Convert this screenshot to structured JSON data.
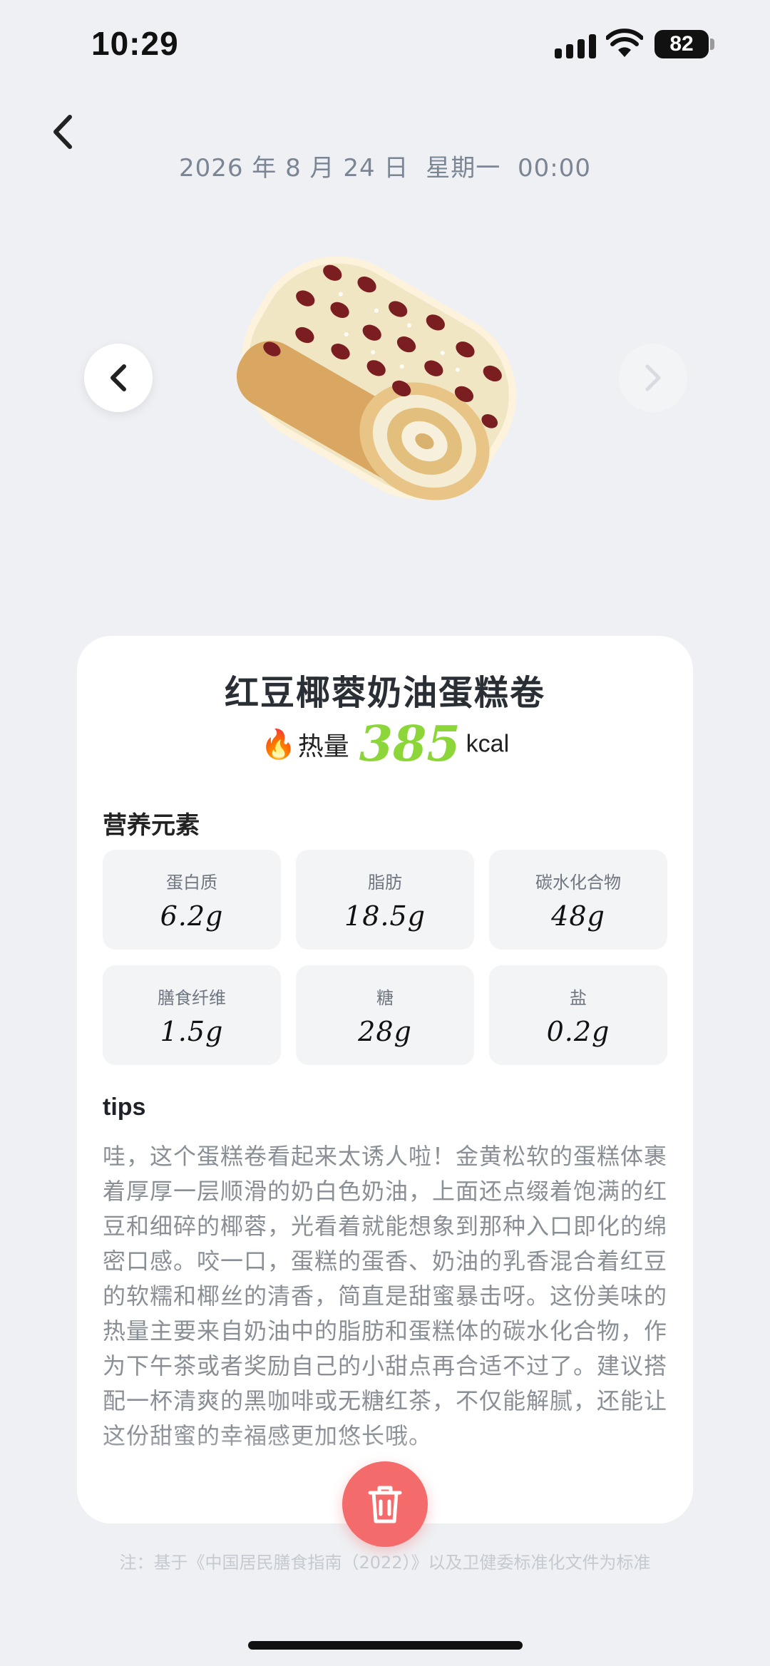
{
  "status_bar": {
    "time": "10:29",
    "battery": "82"
  },
  "header": {
    "date": "2026 年 8 月 24 日",
    "weekday": "星期一",
    "time": "00:00"
  },
  "food": {
    "title": "红豆椰蓉奶油蛋糕卷",
    "calorie_label": "热量",
    "calorie_value": "385",
    "calorie_unit": "kcal"
  },
  "nutrition": {
    "section_label": "营养元素",
    "items": [
      {
        "name": "蛋白质",
        "value": "6.2g"
      },
      {
        "name": "脂肪",
        "value": "18.5g"
      },
      {
        "name": "碳水化合物",
        "value": "48g"
      },
      {
        "name": "膳食纤维",
        "value": "1.5g"
      },
      {
        "name": "糖",
        "value": "28g"
      },
      {
        "name": "盐",
        "value": "0.2g"
      }
    ]
  },
  "tips": {
    "label": "tips",
    "text": "哇，这个蛋糕卷看起来太诱人啦！金黄松软的蛋糕体裹着厚厚一层顺滑的奶白色奶油，上面还点缀着饱满的红豆和细碎的椰蓉，光看着就能想象到那种入口即化的绵密口感。咬一口，蛋糕的蛋香、奶油的乳香混合着红豆的软糯和椰丝的清香，简直是甜蜜暴击呀。这份美味的热量主要来自奶油中的脂肪和蛋糕体的碳水化合物，作为下午茶或者奖励自己的小甜点再合适不过了。建议搭配一杯清爽的黑咖啡或无糖红茶，不仅能解腻，还能让这份甜蜜的幸福感更加悠长哦。"
  },
  "footnote": "注：基于《中国居民膳食指南（2022）》以及卫健委标准化文件为标准",
  "icons": {
    "back": "chevron-left-icon",
    "prev": "chevron-left-icon",
    "next": "chevron-right-icon",
    "delete": "trash-icon",
    "calorie": "fire-icon"
  },
  "colors": {
    "accent_green": "#8cd63a",
    "delete_red": "#f46b6b",
    "background": "#eef0f3"
  }
}
